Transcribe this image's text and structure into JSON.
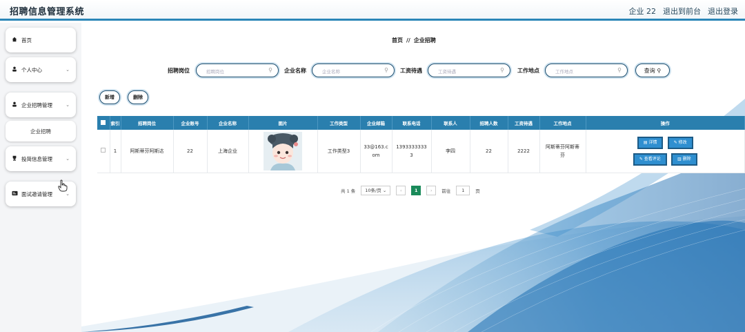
{
  "header": {
    "title": "招聘信息管理系统",
    "links": [
      "企业 22",
      "退出到前台",
      "退出登录"
    ]
  },
  "sidebar": {
    "items": [
      {
        "label": "首页",
        "icon": "home-icon"
      },
      {
        "label": "个人中心",
        "icon": "user-icon"
      },
      {
        "label": "企业招聘管理",
        "icon": "user-icon"
      },
      {
        "label": "企业招聘",
        "icon": ""
      },
      {
        "label": "投简信息管理",
        "icon": "trophy-icon"
      },
      {
        "label": "面试邀请管理",
        "icon": "card-icon"
      }
    ]
  },
  "breadcrumb": {
    "home": "首页",
    "sep": "//",
    "current": "企业招聘"
  },
  "search": {
    "fields": [
      {
        "label": "招聘岗位",
        "placeholder": "招聘岗位"
      },
      {
        "label": "企业名称",
        "placeholder": "企业名称"
      },
      {
        "label": "工资待遇",
        "placeholder": "工资待遇"
      },
      {
        "label": "工作地点",
        "placeholder": "工作地点"
      }
    ],
    "button": "查询"
  },
  "actions": {
    "add": "新增",
    "delete": "删除"
  },
  "table": {
    "headers": [
      "索引",
      "招聘岗位",
      "企业账号",
      "企业名称",
      "图片",
      "工作类型",
      "企业邮箱",
      "联系电话",
      "联系人",
      "招聘人数",
      "工资待遇",
      "工作地点",
      "操作"
    ],
    "rows": [
      {
        "index": "1",
        "position": "阿斯蒂芬阿斯达",
        "account": "22",
        "company": "上海企业",
        "job_type": "工作类型3",
        "email": "33@163.com",
        "phone": "13933333333",
        "contact": "李四",
        "headcount": "22",
        "salary": "2222",
        "location": "阿斯蒂芬阿斯蒂芬",
        "ops": {
          "detail": "详情",
          "edit": "修改",
          "review": "查看评论",
          "delete": "删除"
        }
      }
    ]
  },
  "pagination": {
    "total": "共 1 条",
    "size": "10条/页",
    "current": "1",
    "goto_label": "前往",
    "goto_value": "1",
    "goto_suffix": "页"
  },
  "colors": {
    "accent": "#2a7fae",
    "active_page": "#1a8a5a",
    "header_border": "#2b86b8"
  }
}
